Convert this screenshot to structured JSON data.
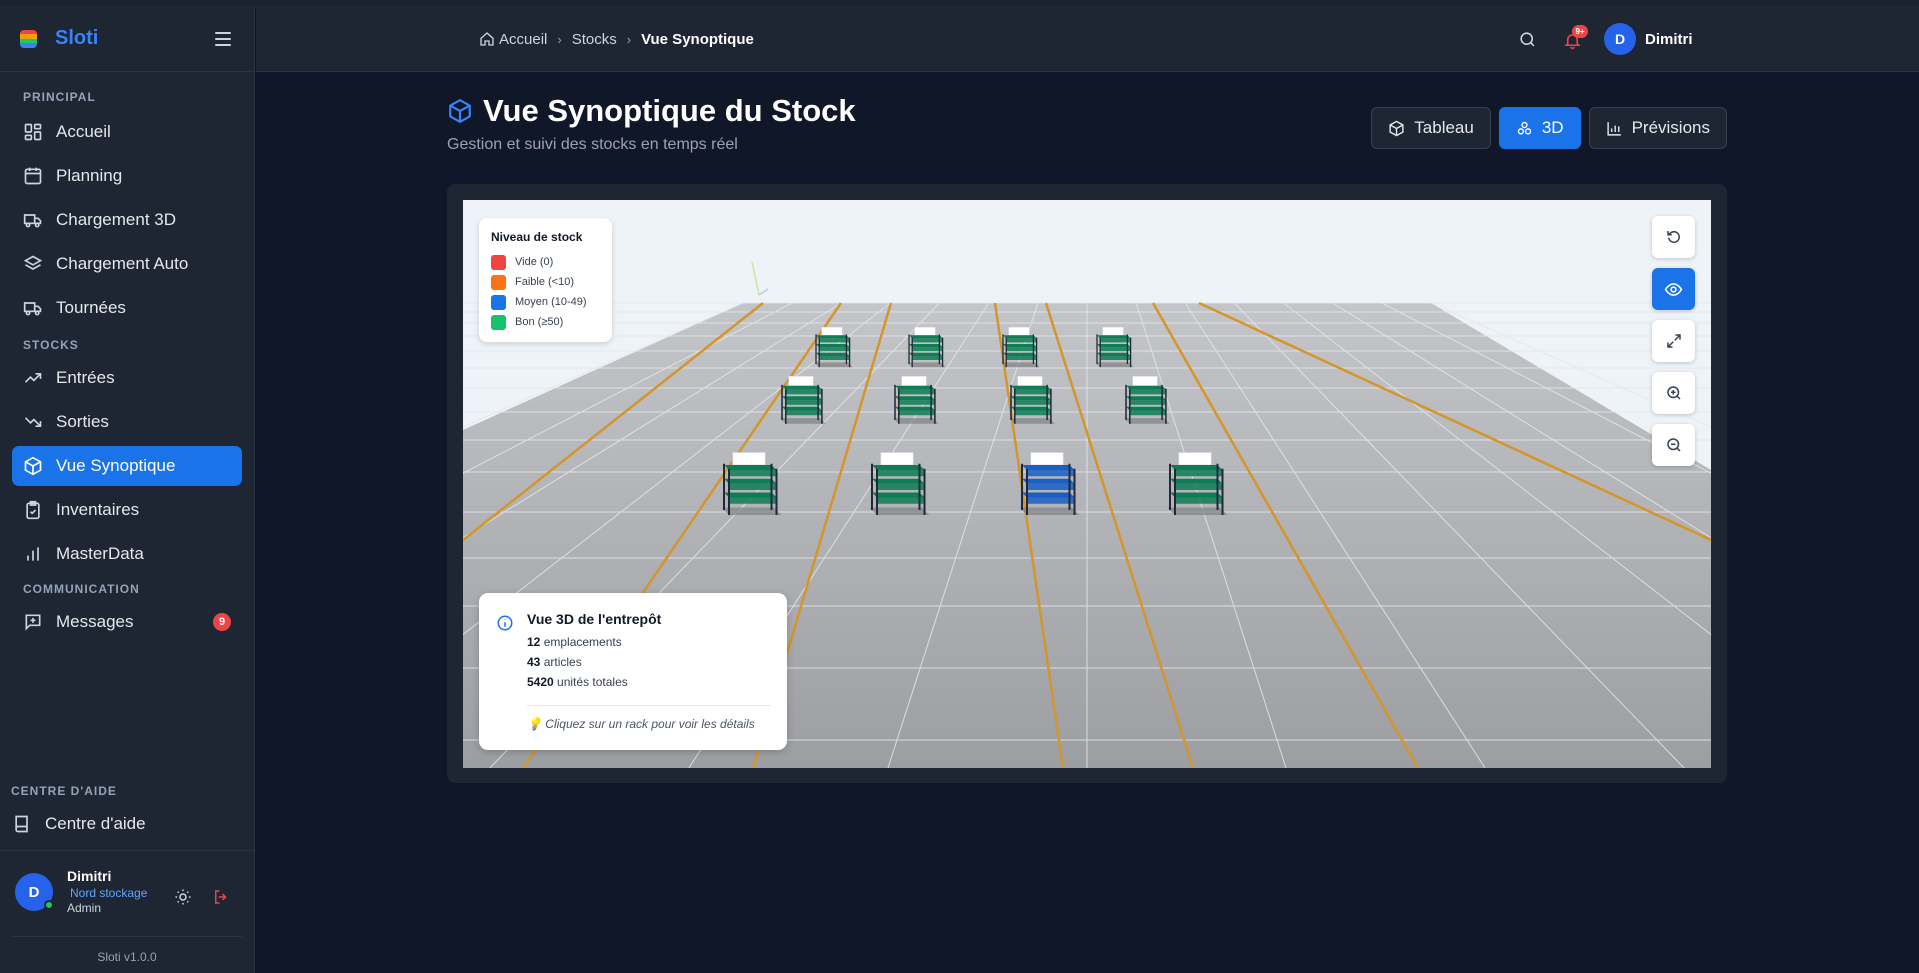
{
  "app": {
    "name": "Sloti",
    "version": "Sloti v1.0.0"
  },
  "sidebar": {
    "sections": [
      {
        "label": "PRINCIPAL"
      },
      {
        "label": "STOCKS"
      },
      {
        "label": "COMMUNICATION"
      },
      {
        "label": "CENTRE D'AIDE"
      }
    ],
    "items": [
      {
        "label": "Accueil",
        "icon": "dashboard-icon"
      },
      {
        "label": "Planning",
        "icon": "calendar-icon"
      },
      {
        "label": "Chargement 3D",
        "icon": "truck-icon"
      },
      {
        "label": "Chargement Auto",
        "icon": "layers-icon"
      },
      {
        "label": "Tournées",
        "icon": "truck-icon"
      },
      {
        "label": "Entrées",
        "icon": "trending-up-icon"
      },
      {
        "label": "Sorties",
        "icon": "trending-down-icon"
      },
      {
        "label": "Vue Synoptique",
        "icon": "cube-icon",
        "active": true
      },
      {
        "label": "Inventaires",
        "icon": "clipboard-check-icon"
      },
      {
        "label": "MasterData",
        "icon": "bar-chart-icon"
      },
      {
        "label": "Messages",
        "icon": "message-plus-icon",
        "badge": "9"
      },
      {
        "label": "Centre d'aide",
        "icon": "book-icon"
      }
    ],
    "user": {
      "initial": "D",
      "name": "Dimitri",
      "site": "Nord stockage",
      "role": "Admin"
    }
  },
  "header": {
    "breadcrumb": [
      "Accueil",
      "Stocks",
      "Vue Synoptique"
    ],
    "notifications_badge": "9+",
    "user": {
      "initial": "D",
      "name": "Dimitri"
    }
  },
  "page": {
    "title": "Vue Synoptique du Stock",
    "subtitle": "Gestion et suivi des stocks en temps réel",
    "views": [
      {
        "label": "Tableau",
        "icon": "cube-outline-icon"
      },
      {
        "label": "3D",
        "icon": "molecule-icon",
        "active": true
      },
      {
        "label": "Prévisions",
        "icon": "bar-chart-icon"
      }
    ]
  },
  "legend": {
    "title": "Niveau de stock",
    "items": [
      {
        "label": "Vide (0)",
        "color": "#ef4444"
      },
      {
        "label": "Faible (<10)",
        "color": "#f97316"
      },
      {
        "label": "Moyen (10-49)",
        "color": "#1a73e8"
      },
      {
        "label": "Bon (≥50)",
        "color": "#16c26b"
      }
    ]
  },
  "scene": {
    "racks": [
      {
        "level": "good"
      },
      {
        "level": "good"
      },
      {
        "level": "good"
      },
      {
        "level": "good"
      },
      {
        "level": "good"
      },
      {
        "level": "good"
      },
      {
        "level": "good"
      },
      {
        "level": "good"
      },
      {
        "level": "good"
      },
      {
        "level": "good"
      },
      {
        "level": "medium"
      },
      {
        "level": "good"
      }
    ],
    "controls": [
      "reset-view",
      "toggle-view",
      "fullscreen",
      "zoom-in",
      "zoom-out"
    ]
  },
  "info": {
    "title": "Vue 3D de l'entrepôt",
    "locations": "12",
    "locations_label": "emplacements",
    "articles": "43",
    "articles_label": "articles",
    "units": "5420",
    "units_label": "unités totales",
    "hint": "Cliquez sur un rack pour voir les détails"
  }
}
